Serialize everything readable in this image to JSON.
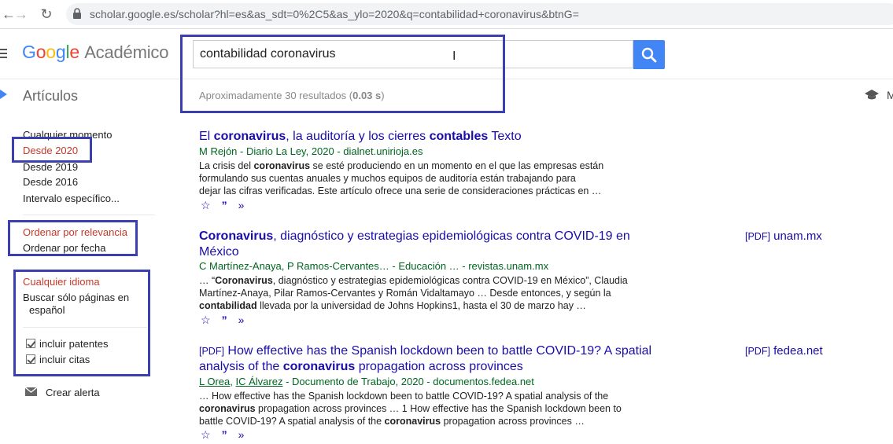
{
  "browser": {
    "url": "scholar.google.es/scholar?hl=es&as_sdt=0%2C5&as_ylo=2020&q=contabilidad+coronavirus&btnG="
  },
  "header": {
    "logo_google": "Google",
    "logo_suffix": "Académico",
    "search_value": "contabilidad coronavirus"
  },
  "subheader": {
    "section": "Artículos",
    "stats_prefix": "Aproximadamente 30 resultados (",
    "stats_time": "0.03 s",
    "stats_suffix": ")"
  },
  "sidebar": {
    "time": [
      "Cualquier momento",
      "Desde 2020",
      "Desde 2019",
      "Desde 2016",
      "Intervalo específico..."
    ],
    "sort": [
      "Ordenar por relevancia",
      "Ordenar por fecha"
    ],
    "lang_any": "Cualquier idioma",
    "lang_es_line1": "Buscar sólo páginas en",
    "lang_es_line2": "español",
    "include_patents": "incluir patentes",
    "include_citations": "incluir citas",
    "create_alert": "Crear alerta"
  },
  "results": [
    {
      "title_parts": [
        [
          "El ",
          false
        ],
        [
          "coronavirus",
          true
        ],
        [
          ", la auditoría y los cierres ",
          false
        ],
        [
          "contables",
          true
        ],
        [
          " Texto",
          false
        ]
      ],
      "meta": "M Rejón - Diario La Ley, 2020 - dialnet.unirioja.es",
      "snippet_lines": [
        [
          [
            "La crisis del ",
            false
          ],
          [
            "coronavirus",
            true
          ],
          [
            " se esté produciendo en un momento en el que las empresas están",
            false
          ]
        ],
        [
          [
            "formulando sus cuentas anuales y muchos equipos de auditoría están trabajando para",
            false
          ]
        ],
        [
          [
            "dejar las cifras verificadas. Este artículo ofrece una serie de consideraciones prácticas en …",
            false
          ]
        ]
      ]
    },
    {
      "title_line1": [
        [
          "Coronavirus",
          true
        ],
        [
          ", diagnóstico y estrategias epidemiológicas contra COVID-19 en",
          false
        ]
      ],
      "title_line2": [
        [
          "México",
          false
        ]
      ],
      "meta": "C Martínez-Anaya, P Ramos-Cervantes… - Educación … - revistas.unam.mx",
      "side_tag": "[PDF]",
      "side_domain": "unam.mx",
      "snippet_lines": [
        [
          [
            "… “",
            false
          ],
          [
            "Coronavirus",
            true
          ],
          [
            ", diagnóstico y estrategias epidemiológicas contra COVID-19 en México”, Claudia",
            false
          ]
        ],
        [
          [
            "Martínez-Anaya, Pilar Ramos-Cervantes y Román Vidaltamayo … Desde entonces, y según la",
            false
          ]
        ],
        [
          [
            "contabilidad",
            true
          ],
          [
            " llevada por la universidad de Johns Hopkins1, hasta el 30 de marzo hay …",
            false
          ]
        ]
      ]
    },
    {
      "tag": "[PDF]",
      "title_line1": [
        [
          "How effective has the Spanish lockdown been to battle COVID-19? A spatial",
          false
        ]
      ],
      "title_line2": [
        [
          "analysis of the ",
          false
        ],
        [
          "coronavirus",
          true
        ],
        [
          " propagation across provinces",
          false
        ]
      ],
      "meta_a1": "L Orea",
      "meta_sep": ", ",
      "meta_a2": "IC Álvarez",
      "meta_rest": " - Documento de Trabajo, 2020 - documentos.fedea.net",
      "side_tag": "[PDF]",
      "side_domain": "fedea.net",
      "snippet_lines": [
        [
          [
            "… How effective has the Spanish lockdown been to battle COVID-19? A spatial analysis of the",
            false
          ]
        ],
        [
          [
            "coronavirus",
            true
          ],
          [
            " propagation across provinces … 1 How effective has the Spanish lockdown been to",
            false
          ]
        ],
        [
          [
            "battle COVID-19? A spatial analysis of the ",
            false
          ],
          [
            "coronavirus",
            true
          ],
          [
            " propagation across provinces …",
            false
          ]
        ]
      ]
    }
  ],
  "icons": {
    "save": "star-icon",
    "cite": "quote-icon",
    "related": "double-chevron-icon"
  },
  "colors": {
    "link": "#1a0dab",
    "meta": "#006621",
    "selected": "#c53929",
    "highlight": "#3b3faf",
    "search_button": "#4285f4"
  }
}
